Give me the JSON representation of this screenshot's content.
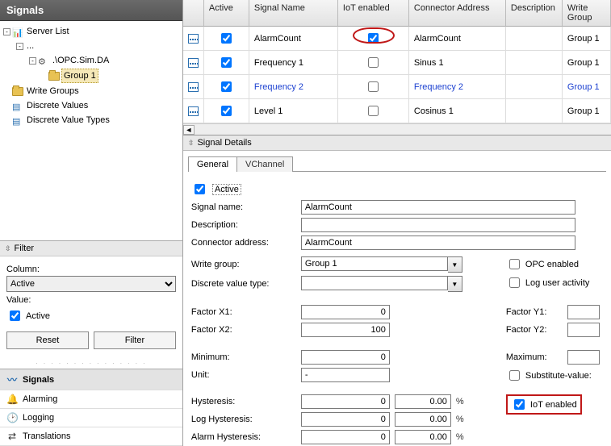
{
  "left": {
    "title": "Signals",
    "tree": {
      "root": "Server List",
      "server": ".\\OPC.Sim.DA",
      "group": "Group 1",
      "writeGroups": "Write Groups",
      "discreteValues": "Discrete Values",
      "discreteValueTypes": "Discrete Value Types"
    },
    "filter": {
      "header": "Filter",
      "columnLabel": "Column:",
      "columnValue": "Active",
      "valueLabel": "Value:",
      "valueCheckLabel": "Active",
      "resetBtn": "Reset",
      "filterBtn": "Filter"
    },
    "nav": {
      "signals": "Signals",
      "alarming": "Alarming",
      "logging": "Logging",
      "translations": "Translations"
    }
  },
  "grid": {
    "headers": {
      "active": "Active",
      "name": "Signal Name",
      "iot": "IoT enabled",
      "conn": "Connector Address",
      "desc": "Description",
      "wg": "Write Group"
    },
    "rows": [
      {
        "name": "AlarmCount",
        "iot": true,
        "conn": "AlarmCount",
        "wg": "Group 1",
        "link": false
      },
      {
        "name": "Frequency 1",
        "iot": false,
        "conn": "Sinus 1",
        "wg": "Group 1",
        "link": false
      },
      {
        "name": "Frequency 2",
        "iot": false,
        "conn": "Frequency 2",
        "wg": "Group 1",
        "link": true
      },
      {
        "name": "Level 1",
        "iot": false,
        "conn": "Cosinus 1",
        "wg": "Group 1",
        "link": false
      }
    ]
  },
  "details": {
    "header": "Signal Details",
    "tabs": {
      "general": "General",
      "vchannel": "VChannel"
    },
    "activeLabel": "Active",
    "signalNameLabel": "Signal name:",
    "signalName": "AlarmCount",
    "descriptionLabel": "Description:",
    "description": "",
    "connAddrLabel": "Connector address:",
    "connAddr": "AlarmCount",
    "writeGroupLabel": "Write group:",
    "writeGroup": "Group 1",
    "discreteTypeLabel": "Discrete value type:",
    "discreteType": "",
    "opcEnabled": "OPC enabled",
    "logUser": "Log user activity",
    "factorX1Label": "Factor X1:",
    "factorX1": "0",
    "factorX2Label": "Factor X2:",
    "factorX2": "100",
    "factorY1Label": "Factor Y1:",
    "factorY1": "",
    "factorY2Label": "Factor Y2:",
    "factorY2": "",
    "minLabel": "Minimum:",
    "min": "0",
    "maxLabel": "Maximum:",
    "max": "",
    "unitLabel": "Unit:",
    "unit": "-",
    "subValLabel": "Substitute-value:",
    "hystLabel": "Hysteresis:",
    "hyst": "0",
    "hystPct": "0.00",
    "logHystLabel": "Log Hysteresis:",
    "logHyst": "0",
    "logHystPct": "0.00",
    "alarmHystLabel": "Alarm Hysteresis:",
    "alarmHyst": "0",
    "alarmHystPct": "0.00",
    "iotEnabled": "IoT enabled",
    "pct": "%"
  }
}
